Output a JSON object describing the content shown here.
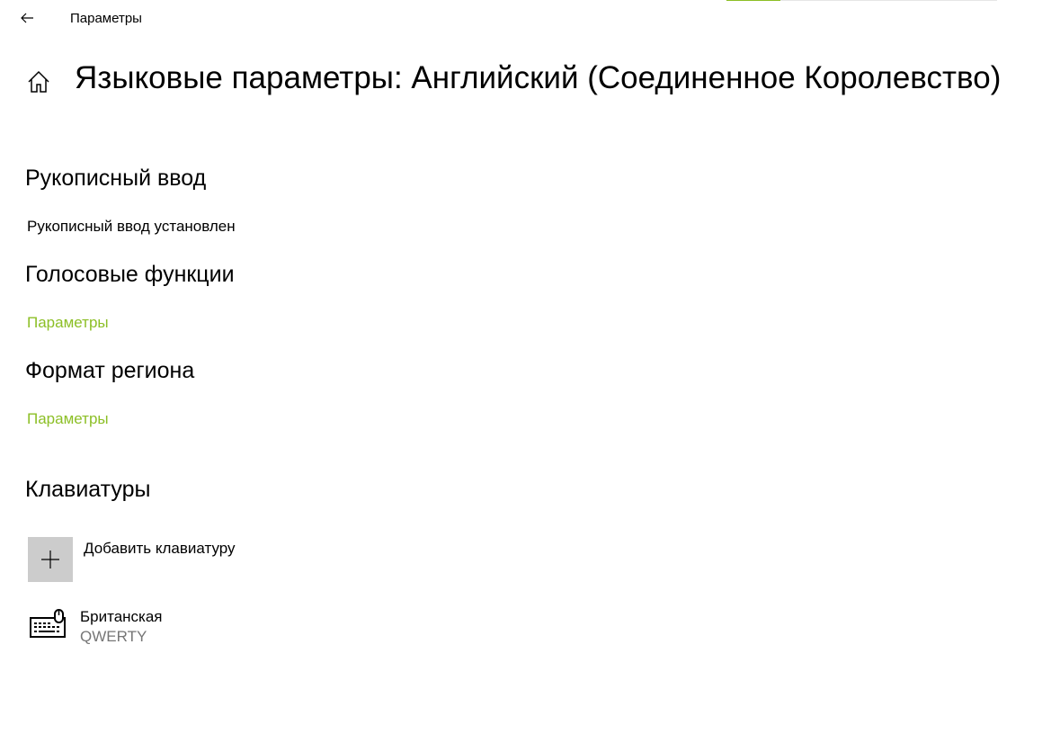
{
  "titlebar": {
    "app_title": "Параметры",
    "progress_fraction": 0.2
  },
  "page": {
    "title": "Языковые параметры: Английский (Соединенное Королевство)"
  },
  "sections": {
    "handwriting": {
      "heading": "Рукописный ввод",
      "status": "Рукописный ввод установлен"
    },
    "speech": {
      "heading": "Голосовые функции",
      "link": "Параметры"
    },
    "region": {
      "heading": "Формат региона",
      "link": "Параметры"
    },
    "keyboards": {
      "heading": "Клавиатуры",
      "add_label": "Добавить клавиатуру",
      "items": [
        {
          "name": "Британская",
          "layout": "QWERTY"
        }
      ]
    }
  },
  "colors": {
    "accent": "#8cbf26",
    "tile": "#cccccc",
    "secondary_text": "#767676"
  },
  "icons": {
    "back": "back-arrow-icon",
    "home": "home-icon",
    "add": "plus-icon",
    "keyboard": "keyboard-icon"
  }
}
